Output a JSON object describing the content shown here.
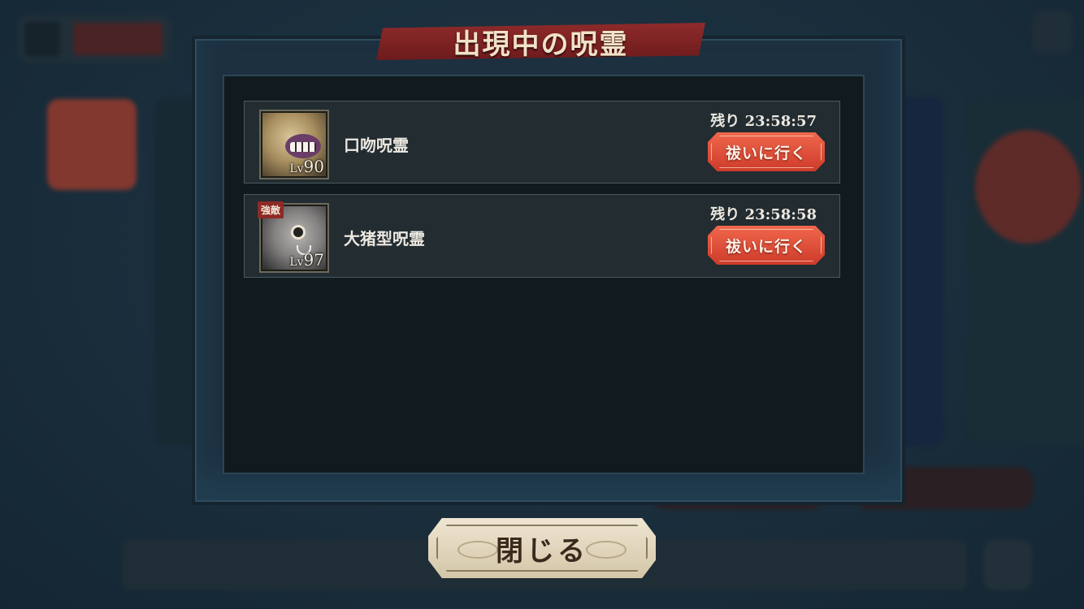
{
  "dialog": {
    "title": "出現中の呪霊"
  },
  "spirits": [
    {
      "name": "口吻呪霊",
      "level_prefix": "Lv",
      "level": "90",
      "remaining_label": "残り",
      "remaining_time": "23:58:57",
      "action_label": "祓いに行く",
      "strong_tag": ""
    },
    {
      "name": "大猪型呪霊",
      "level_prefix": "Lv",
      "level": "97",
      "remaining_label": "残り",
      "remaining_time": "23:58:58",
      "action_label": "祓いに行く",
      "strong_tag": "強敵"
    }
  ],
  "close_button": {
    "label": "閉じる"
  },
  "colors": {
    "accent_red": "#e04e38",
    "title_banner": "#7d2223",
    "panel_bg": "#111a1e"
  }
}
